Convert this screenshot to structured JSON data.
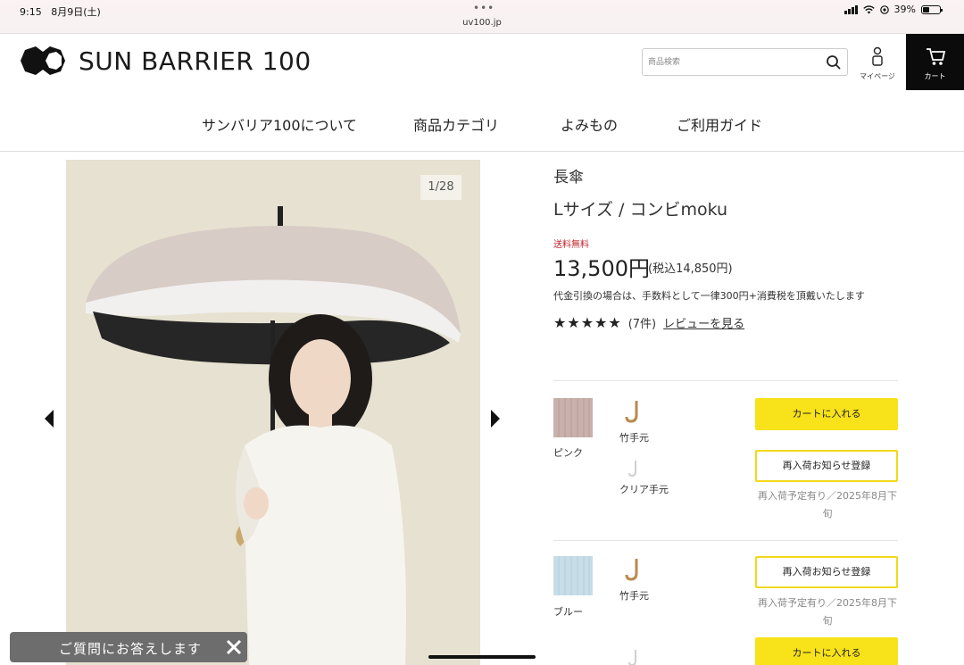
{
  "status": {
    "time": "9:15",
    "date": "8月9日(土)",
    "dots": "•••",
    "url": "uv100.jp",
    "battery": "39%"
  },
  "header": {
    "logo_text": "SUN BARRIER 100",
    "search_placeholder": "商品検索",
    "mypage_label": "マイページ",
    "cart_label": "カート"
  },
  "nav": {
    "items": [
      {
        "label": "サンバリア100について"
      },
      {
        "label": "商品カテゴリ"
      },
      {
        "label": "よみもの"
      },
      {
        "label": "ご利用ガイド"
      }
    ]
  },
  "gallery": {
    "counter": "1/28"
  },
  "product": {
    "category": "長傘",
    "name": "Lサイズ / コンビmoku",
    "free_shipping": "送料無料",
    "price": "13,500円",
    "price_tax": "(税込14,850円)",
    "cod_note": "代金引換の場合は、手数料として一律300円+消費税を頂戴いたします",
    "rating": 5,
    "review_count": "(7件)",
    "review_link": "レビューを見る"
  },
  "variants": [
    {
      "color_name": "ピンク",
      "swatch_color": "#c8b1ad",
      "handles": [
        {
          "label": "竹手元",
          "icon": "bamboo-handle-icon",
          "color": "#b98a50"
        },
        {
          "label": "クリア手元",
          "icon": "clear-handle-icon",
          "color": "#cfcfcf"
        }
      ],
      "cart_label": "カートに入れる",
      "notify_label": "再入荷お知らせ登録",
      "restock_text": "再入荷予定有り／2025年8月下旬"
    },
    {
      "color_name": "ブルー",
      "swatch_color": "#c7dde8",
      "handles": [
        {
          "label": "竹手元",
          "icon": "bamboo-handle-icon",
          "color": "#b98a50"
        }
      ],
      "notify_label": "再入荷お知らせ登録",
      "restock_text": "再入荷予定有り／2025年8月下旬",
      "cart_label": "カートに入れる"
    }
  ],
  "chat": {
    "label": "ご質問にお答えします"
  },
  "colors": {
    "accent_yellow": "#f8e21a",
    "price_red": "#c0242b",
    "cart_bg": "#0b0b0b"
  }
}
